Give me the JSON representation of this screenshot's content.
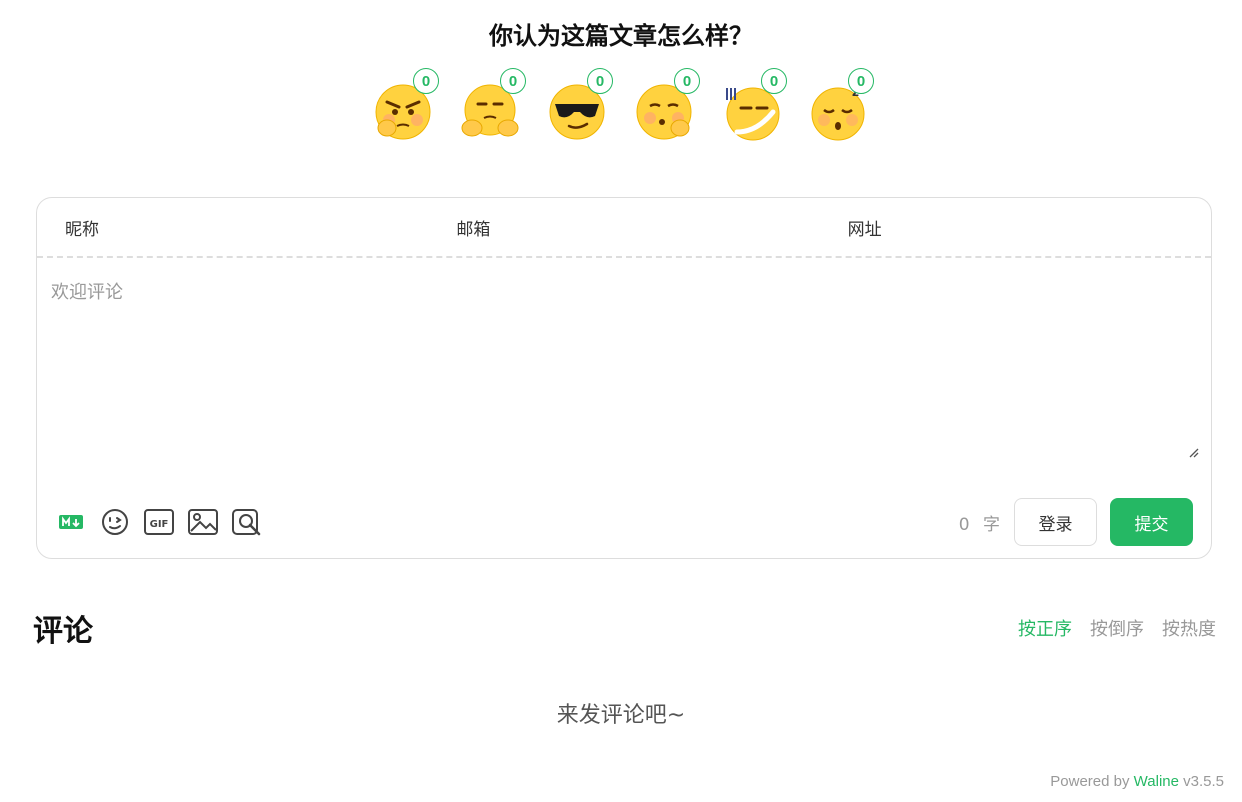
{
  "reaction": {
    "title": "你认为这篇文章怎么样？",
    "items": [
      {
        "icon": "thinking-face-icon",
        "count": "0"
      },
      {
        "icon": "shrugging-face-icon",
        "count": "0"
      },
      {
        "icon": "sunglasses-face-icon",
        "count": "0"
      },
      {
        "icon": "pondering-face-icon",
        "count": "0"
      },
      {
        "icon": "awkward-face-icon",
        "count": "0"
      },
      {
        "icon": "sleepy-face-icon",
        "count": "0"
      }
    ]
  },
  "form": {
    "nick_label": "昵称",
    "mail_label": "邮箱",
    "link_label": "网址",
    "editor_placeholder": "欢迎评论",
    "word_count": "0",
    "word_unit": "字",
    "login_label": "登录",
    "submit_label": "提交"
  },
  "comments": {
    "title": "评论",
    "sort": [
      "按正序",
      "按倒序",
      "按热度"
    ],
    "empty_text": "来发评论吧~"
  },
  "footer": {
    "powered_prefix": "Powered by ",
    "brand": "Waline",
    "version": " v3.5.5"
  },
  "colors": {
    "accent": "#25b864"
  }
}
